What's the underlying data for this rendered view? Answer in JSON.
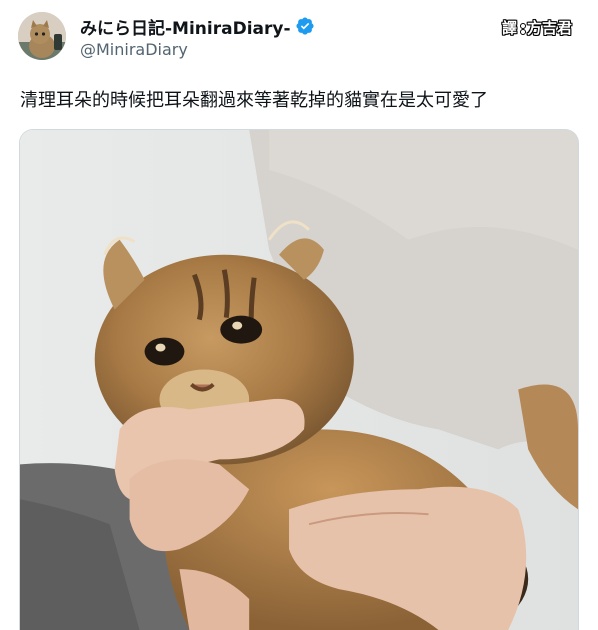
{
  "author": {
    "display_name": "みにら日記-MiniraDiary-",
    "handle": "@MiniraDiary",
    "verified": true,
    "avatar_icon": "cat-avatar",
    "verified_icon": "verified-badge-icon",
    "verified_color": "#1d9bf0"
  },
  "watermark": {
    "left": "譯",
    "right": "方吉君"
  },
  "tweet": {
    "text": "清理耳朵的時候把耳朵翻過來等著乾掉的貓實在是太可愛了"
  },
  "media": {
    "type": "photo",
    "subject": "cat-photo"
  }
}
